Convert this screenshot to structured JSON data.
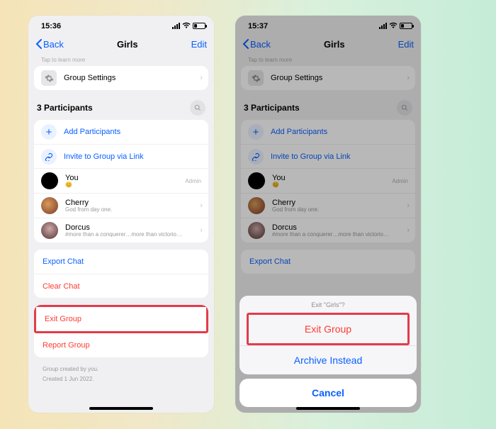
{
  "screens": [
    {
      "status": {
        "time": "15:36"
      },
      "nav": {
        "back": "Back",
        "title": "Girls",
        "edit": "Edit"
      },
      "hint": "Tap to learn more",
      "group_settings": "Group Settings",
      "participants_header": "3 Participants",
      "add_participants": "Add Participants",
      "invite_link": "Invite to Group via Link",
      "members": [
        {
          "name": "You",
          "sub": "😊",
          "role": "Admin"
        },
        {
          "name": "Cherry",
          "sub": "God from day one."
        },
        {
          "name": "Dorcus",
          "sub": "#more than a conquerer…more than victorio…"
        }
      ],
      "actions": {
        "export": "Export Chat",
        "clear": "Clear Chat",
        "exit": "Exit Group",
        "report": "Report Group"
      },
      "footer": {
        "line1": "Group created by you.",
        "line2": "Created 1 Jun 2022."
      }
    },
    {
      "status": {
        "time": "15:37"
      },
      "nav": {
        "back": "Back",
        "title": "Girls",
        "edit": "Edit"
      },
      "hint": "Tap to learn more",
      "group_settings": "Group Settings",
      "participants_header": "3 Participants",
      "add_participants": "Add Participants",
      "invite_link": "Invite to Group via Link",
      "members": [
        {
          "name": "You",
          "sub": "😊",
          "role": "Admin"
        },
        {
          "name": "Cherry",
          "sub": "God from day one."
        },
        {
          "name": "Dorcus",
          "sub": "#more than a conquerer…more than victorio…"
        }
      ],
      "actions": {
        "export": "Export Chat"
      },
      "sheet": {
        "title": "Exit \"Girls\"?",
        "exit": "Exit Group",
        "archive": "Archive Instead",
        "cancel": "Cancel"
      }
    }
  ]
}
